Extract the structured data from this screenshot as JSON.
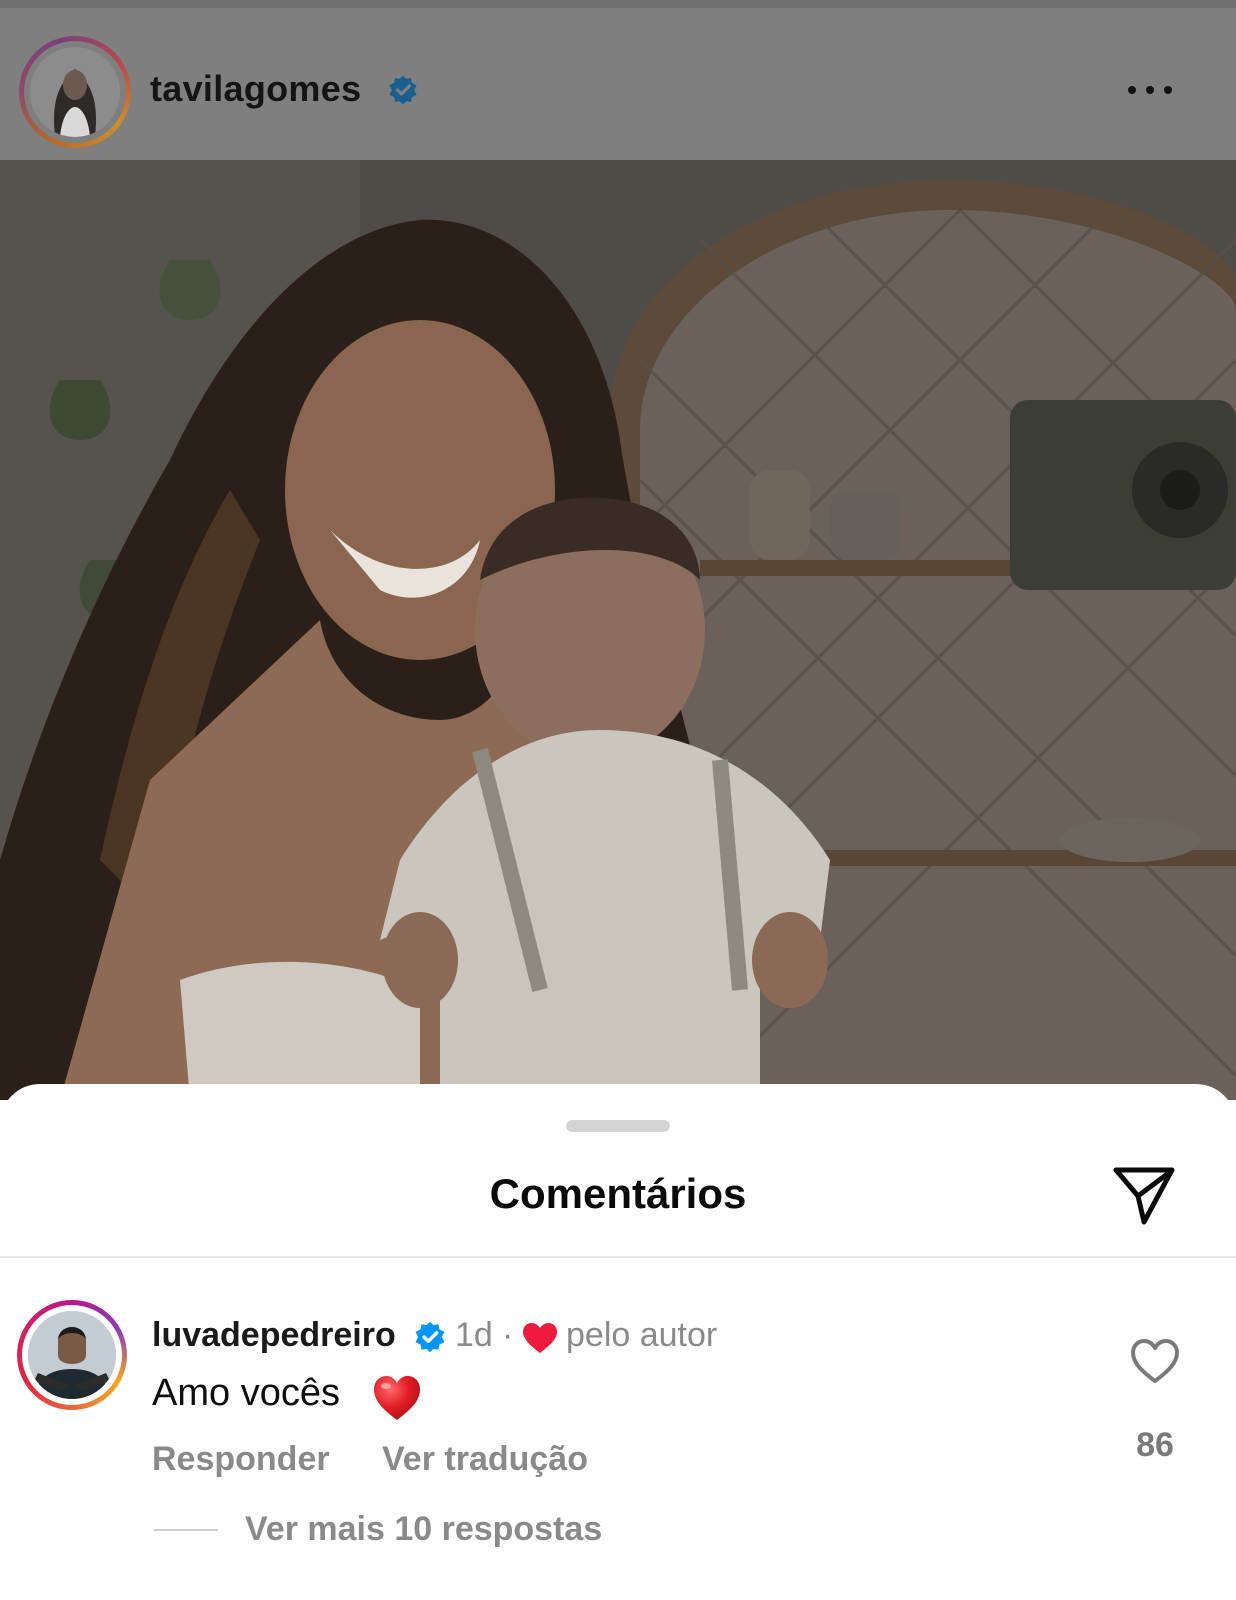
{
  "post": {
    "username": "tavilagomes",
    "verified": true,
    "avatar_icon": "profile-photo",
    "more_icon": "more-horizontal-icon"
  },
  "photo": {
    "icon": "post-image"
  },
  "comments_sheet": {
    "title": "Comentários",
    "share_icon": "paper-plane-icon"
  },
  "comment": {
    "username": "luvadepedreiro",
    "verified": true,
    "time": "1d",
    "separator": "·",
    "liked_by_author_label": "pelo autor",
    "text": "Amo vocês",
    "emoji_icon": "red-heart-emoji",
    "reply_label": "Responder",
    "translate_label": "Ver tradução",
    "like_count": "86",
    "view_more_replies": "Ver mais 10 respostas"
  },
  "colors": {
    "dim_overlay": "#7f7f7f",
    "verified_blue": "#0095f6",
    "heart_red": "#ed1c3f",
    "secondary_text": "#8a8a8a"
  }
}
